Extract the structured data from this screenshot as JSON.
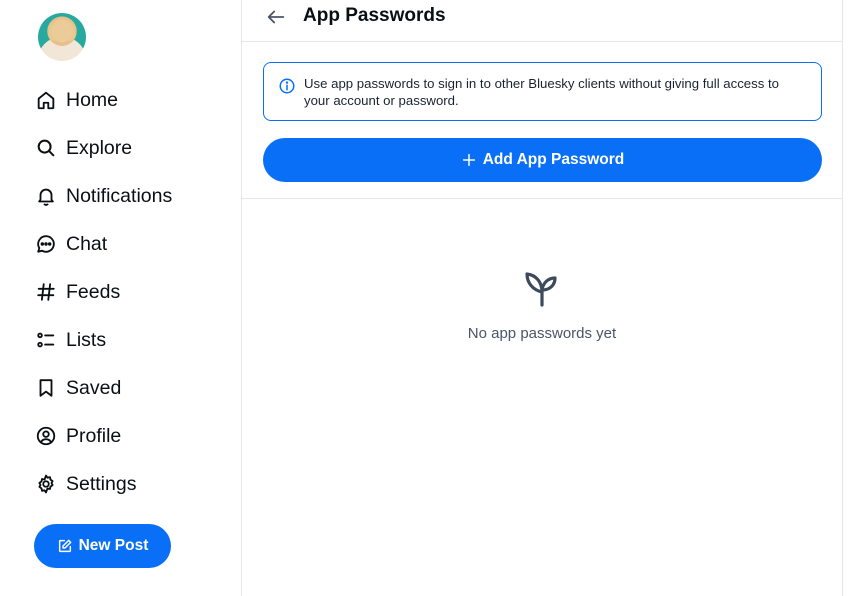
{
  "sidebar": {
    "avatar_alt": "",
    "items": [
      {
        "label": "Home",
        "icon": "home-icon"
      },
      {
        "label": "Explore",
        "icon": "search-icon"
      },
      {
        "label": "Notifications",
        "icon": "bell-icon"
      },
      {
        "label": "Chat",
        "icon": "chat-bubble-icon"
      },
      {
        "label": "Feeds",
        "icon": "hashtag-icon"
      },
      {
        "label": "Lists",
        "icon": "list-icon"
      },
      {
        "label": "Saved",
        "icon": "bookmark-icon"
      },
      {
        "label": "Profile",
        "icon": "user-circle-icon"
      },
      {
        "label": "Settings",
        "icon": "gear-icon"
      }
    ],
    "new_post_label": "New Post"
  },
  "header": {
    "title": "App Passwords"
  },
  "info": {
    "text": "Use app passwords to sign in to other Bluesky clients without giving full access to your account or password."
  },
  "actions": {
    "add_label": "Add App Password"
  },
  "empty_state": {
    "text": "No app passwords yet",
    "icon": "sprout-icon"
  },
  "colors": {
    "accent": "#0a6ff7",
    "border": "#e3e7ec",
    "text": "#0b0f14",
    "muted": "#4b5567"
  }
}
